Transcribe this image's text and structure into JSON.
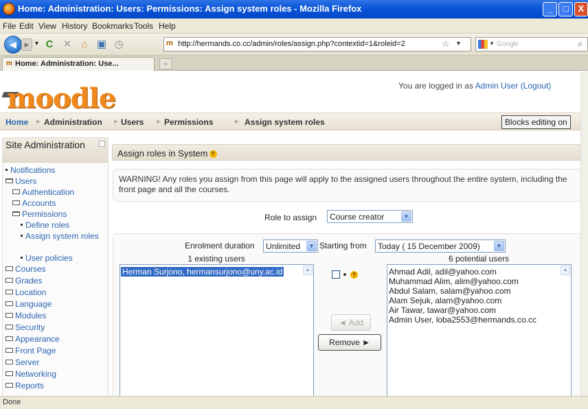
{
  "window": {
    "title": "Home: Administration: Users: Permissions: Assign system roles - Mozilla Firefox",
    "buttons": {
      "minimize": "_",
      "maximize": "□",
      "close": "X"
    }
  },
  "menubar": [
    "File",
    "Edit",
    "View",
    "History",
    "Bookmarks",
    "Tools",
    "Help"
  ],
  "toolbar": {
    "url": "http://hermands.co.cc/admin/roles/assign.php?contextid=1&roleid=2",
    "search_placeholder": "Google",
    "icons": [
      "back-icon",
      "forward-icon",
      "reload-icon",
      "stop-icon",
      "home-icon",
      "bookmark-icon",
      "history-icon"
    ]
  },
  "tabs": [
    {
      "label": "Home: Administration: Use...",
      "active": true
    }
  ],
  "header": {
    "logo": "moodle",
    "login_prefix": "You are logged in as ",
    "login_user": "Admin User",
    "logout": "(Logout)"
  },
  "breadcrumb": [
    "Home",
    "Administration",
    "Users",
    "Permissions",
    "Assign system roles"
  ],
  "blocks_editing_button": "Blocks editing on",
  "sidebar": {
    "title": "Site Administration",
    "items": [
      {
        "label": "Notifications"
      },
      {
        "label": "Users"
      },
      {
        "label": "Authentication"
      },
      {
        "label": "Accounts"
      },
      {
        "label": "Permissions"
      },
      {
        "label": "Define roles"
      },
      {
        "label": "Assign system roles"
      },
      {
        "label": "User policies"
      },
      {
        "label": "Courses"
      },
      {
        "label": "Grades"
      },
      {
        "label": "Location"
      },
      {
        "label": "Language"
      },
      {
        "label": "Modules"
      },
      {
        "label": "Security"
      },
      {
        "label": "Appearance"
      },
      {
        "label": "Front Page"
      },
      {
        "label": "Server"
      },
      {
        "label": "Networking"
      },
      {
        "label": "Reports"
      }
    ]
  },
  "main": {
    "heading": "Assign roles in System",
    "warning": "WARNING! Any roles you assign from this page will apply to the assigned users throughout the entire system, including the front page and all the courses.",
    "role_label": "Role to assign",
    "role_value": "Course creator",
    "enrolment_label": "Enrolment duration",
    "enrolment_value": "Unlimited",
    "starting_label": "Starting from",
    "starting_value": "Today ( 15 December 2009)",
    "existing_caption": "1 existing users",
    "potential_caption": "6 potential users",
    "existing_users": [
      "Herman Surjono, hermansurjono@uny.ac.id"
    ],
    "potential_users": [
      "Ahmad Adil, adil@yahoo.com",
      "Muhammad Alim, alim@yahoo.com",
      "Abdul Salam, salam@yahoo.com",
      "Alam Sejuk, alam@yahoo.com",
      "Air Tawar, tawar@yahoo.com",
      "Admin User, loba2553@hermands.co.cc"
    ],
    "add_button": "◄ Add",
    "remove_button": "Remove ►"
  },
  "status": "Done"
}
